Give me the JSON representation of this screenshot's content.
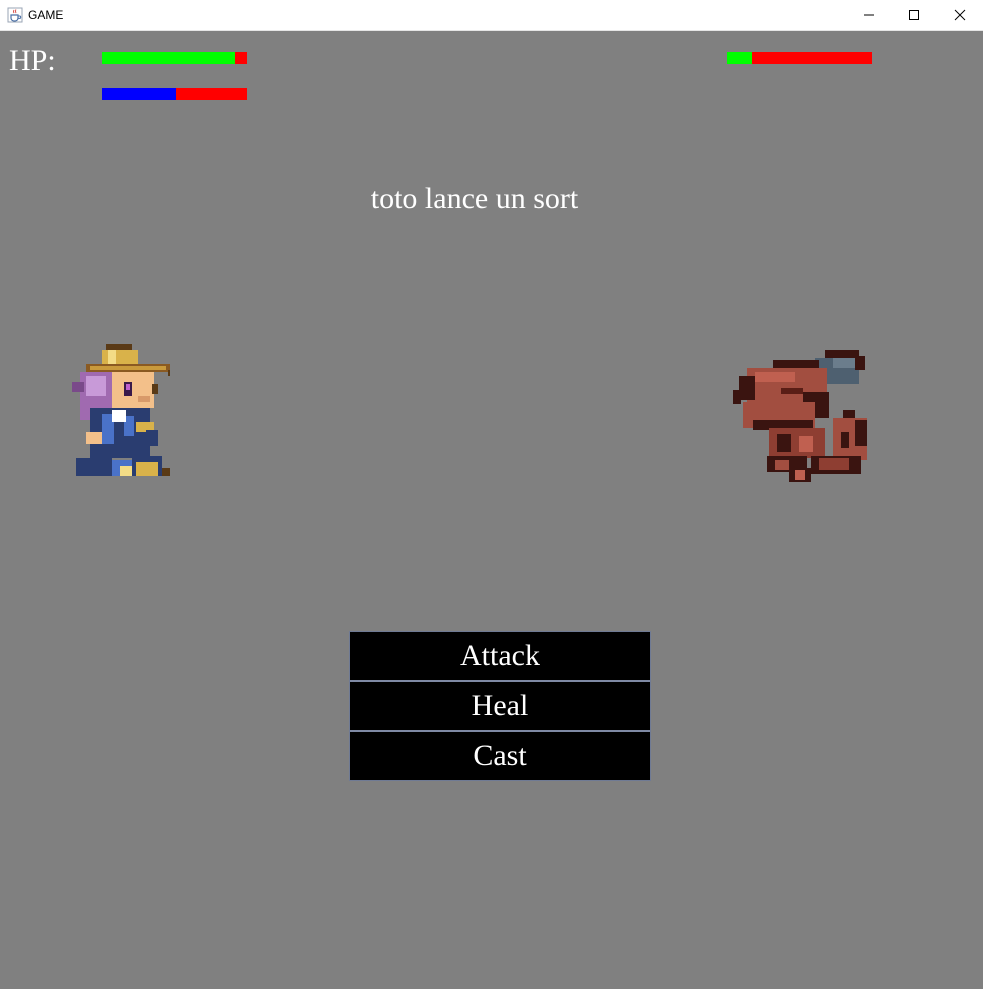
{
  "window": {
    "title": "GAME",
    "icon": "java-cup-icon"
  },
  "hud": {
    "hp_label": "HP:",
    "player_hp_fraction": 0.92,
    "player_mp_fraction": 0.51,
    "enemy_hp_fraction": 0.17,
    "colors": {
      "hp_fill": "#00ff00",
      "mp_fill": "#0000ff",
      "bar_empty": "#ff0000",
      "background": "#808080"
    }
  },
  "message": "toto lance un sort",
  "menu": {
    "items": [
      {
        "label": "Attack"
      },
      {
        "label": "Heal"
      },
      {
        "label": "Cast"
      }
    ]
  },
  "sprites": {
    "player": "adventurer-hero-sprite",
    "enemy": "red-dragon-sprite"
  }
}
